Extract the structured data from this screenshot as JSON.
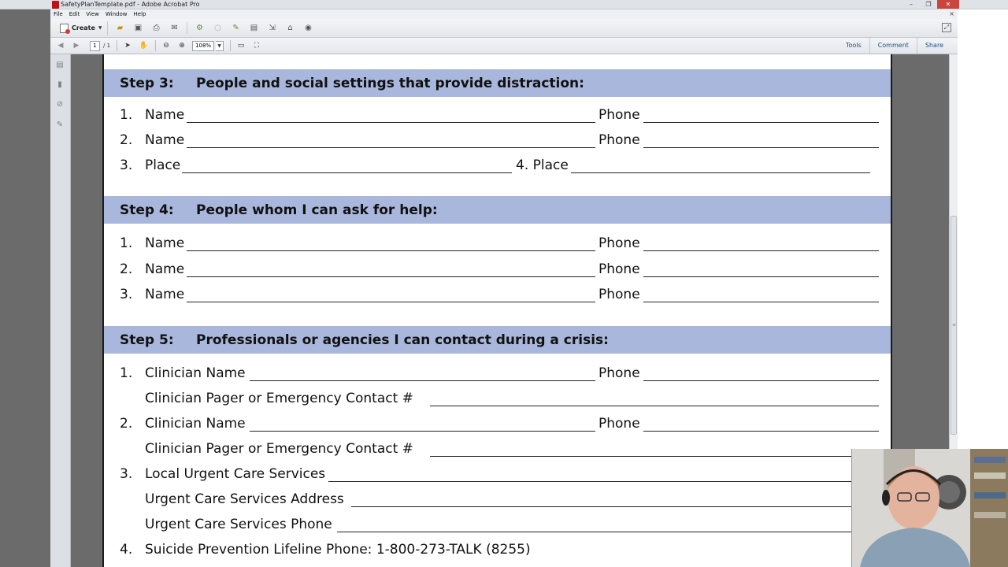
{
  "window": {
    "title": "SafetyPlanTemplate.pdf - Adobe Acrobat Pro",
    "controls": [
      "–",
      "❐",
      "✕"
    ]
  },
  "menubar": {
    "items": [
      "File",
      "Edit",
      "View",
      "Window",
      "Help"
    ],
    "close_glyph": "×"
  },
  "toolbar": {
    "create_label": "Create",
    "icons": [
      "folder-open-icon",
      "save-icon",
      "print-icon",
      "email-icon",
      "settings-gear-icon",
      "comment-icon",
      "sign-icon",
      "document-icon",
      "export-icon",
      "stamp-icon",
      "pin-icon"
    ]
  },
  "navbar": {
    "page_current": "1",
    "page_total": "/ 1",
    "zoom_value": "108%",
    "links": [
      "Tools",
      "Comment",
      "Share"
    ]
  },
  "document": {
    "header_color": "#a9b7dc",
    "step3": {
      "number": "Step 3:",
      "title": "People and social settings that provide distraction:",
      "rows": [
        {
          "num": "1.",
          "label": "Name",
          "right_label": "Phone"
        },
        {
          "num": "2.",
          "label": "Name",
          "right_label": "Phone"
        },
        {
          "num": "3.",
          "label": "Place",
          "right_label": "4. Place"
        }
      ]
    },
    "step4": {
      "number": "Step 4:",
      "title": "People whom I can ask for help:",
      "rows": [
        {
          "num": "1.",
          "label": "Name",
          "right_label": "Phone"
        },
        {
          "num": "2.",
          "label": "Name",
          "right_label": "Phone"
        },
        {
          "num": "3.",
          "label": "Name",
          "right_label": "Phone"
        }
      ]
    },
    "step5": {
      "number": "Step 5:",
      "title": "Professionals or agencies I can contact during a crisis:",
      "rows": [
        {
          "num": "1.",
          "label": "Clinician Name",
          "right_label": "Phone"
        },
        {
          "label": "Clinician Pager or Emergency Contact #"
        },
        {
          "num": "2.",
          "label": "Clinician Name",
          "right_label": "Phone"
        },
        {
          "label": "Clinician Pager or Emergency Contact #"
        },
        {
          "num": "3.",
          "label": "Local Urgent Care Services"
        },
        {
          "label": "Urgent Care Services Address"
        },
        {
          "label": "Urgent Care Services Phone"
        },
        {
          "num": "4.",
          "label": "Suicide Prevention Lifeline Phone: 1-800-273-TALK (8255)"
        }
      ]
    }
  }
}
